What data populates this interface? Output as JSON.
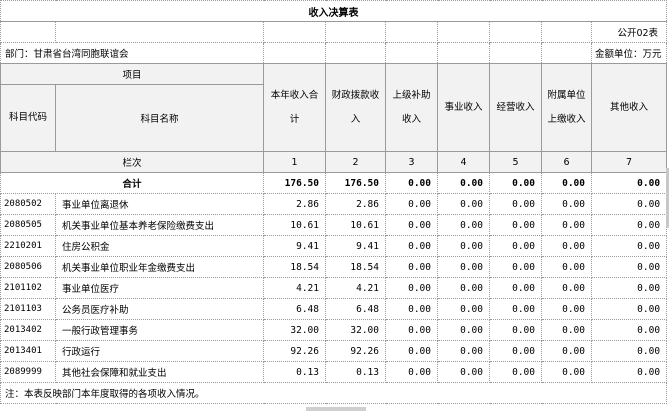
{
  "title": "收入决算表",
  "form_number": "公开02表",
  "department": "部门：甘肃省台湾同胞联谊会",
  "unit": "金额单位：万元",
  "headers": {
    "item_group": "项目",
    "code": "科目代码",
    "name": "科目名称",
    "columns": [
      "本年收入合计",
      "财政拨款收入",
      "上级补助收入",
      "事业收入",
      "经营收入",
      "附属单位上缴收入",
      "其他收入"
    ]
  },
  "row_number_label": "栏次",
  "column_numbers": [
    "1",
    "2",
    "3",
    "4",
    "5",
    "6",
    "7"
  ],
  "total_label": "合计",
  "totals": [
    "176.50",
    "176.50",
    "0.00",
    "0.00",
    "0.00",
    "0.00",
    "0.00"
  ],
  "rows": [
    {
      "code": "2080502",
      "name": "事业单位离退休",
      "values": [
        "2.86",
        "2.86",
        "0.00",
        "0.00",
        "0.00",
        "0.00",
        "0.00"
      ]
    },
    {
      "code": "2080505",
      "name": "机关事业单位基本养老保险缴费支出",
      "values": [
        "10.61",
        "10.61",
        "0.00",
        "0.00",
        "0.00",
        "0.00",
        "0.00"
      ]
    },
    {
      "code": "2210201",
      "name": "住房公积金",
      "values": [
        "9.41",
        "9.41",
        "0.00",
        "0.00",
        "0.00",
        "0.00",
        "0.00"
      ]
    },
    {
      "code": "2080506",
      "name": "机关事业单位职业年金缴费支出",
      "values": [
        "18.54",
        "18.54",
        "0.00",
        "0.00",
        "0.00",
        "0.00",
        "0.00"
      ]
    },
    {
      "code": "2101102",
      "name": "事业单位医疗",
      "values": [
        "4.21",
        "4.21",
        "0.00",
        "0.00",
        "0.00",
        "0.00",
        "0.00"
      ]
    },
    {
      "code": "2101103",
      "name": "公务员医疗补助",
      "values": [
        "6.48",
        "6.48",
        "0.00",
        "0.00",
        "0.00",
        "0.00",
        "0.00"
      ]
    },
    {
      "code": "2013402",
      "name": "一般行政管理事务",
      "values": [
        "32.00",
        "32.00",
        "0.00",
        "0.00",
        "0.00",
        "0.00",
        "0.00"
      ]
    },
    {
      "code": "2013401",
      "name": "行政运行",
      "values": [
        "92.26",
        "92.26",
        "0.00",
        "0.00",
        "0.00",
        "0.00",
        "0.00"
      ]
    },
    {
      "code": "2089999",
      "name": "其他社会保障和就业支出",
      "values": [
        "0.13",
        "0.13",
        "0.00",
        "0.00",
        "0.00",
        "0.00",
        "0.00"
      ]
    }
  ],
  "note": "注：本表反映部门本年度取得的各项收入情况。"
}
